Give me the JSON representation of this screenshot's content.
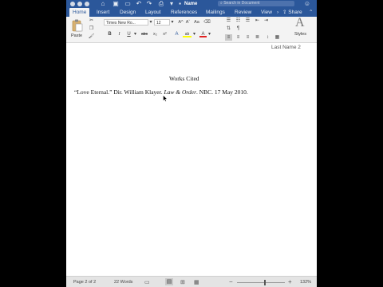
{
  "window": {
    "title": "Name",
    "search_placeholder": "Search in Document"
  },
  "tabs": [
    "Home",
    "Insert",
    "Design",
    "Layout",
    "References",
    "Mailings",
    "Review",
    "View"
  ],
  "tab_share": "Share",
  "ribbon": {
    "paste_label": "Paste",
    "font_name": "Times New Ro...",
    "font_size": "12",
    "styles_label": "Styles",
    "bold": "B",
    "italic": "I",
    "underline": "U",
    "strike": "abc",
    "subscript": "x₂",
    "superscript": "x²",
    "grow_font": "A^",
    "shrink_font": "Aˇ",
    "change_case": "Aa",
    "font_color": "A",
    "highlight": "ab",
    "styles_glyph": "A"
  },
  "document": {
    "header": "Last Name  2",
    "heading": "Works Cited",
    "entry_part1": "“Love Eternal.” Dir. William Klayer. ",
    "entry_italic": "Law & Order",
    "entry_part2": ". NBC. 17 May 2010."
  },
  "status": {
    "page": "Page 2 of 2",
    "words": "22 Words",
    "zoom": "132%"
  },
  "colors": {
    "accent": "#2b579a",
    "highlight": "#ffff00",
    "font_color": "#e02020"
  }
}
